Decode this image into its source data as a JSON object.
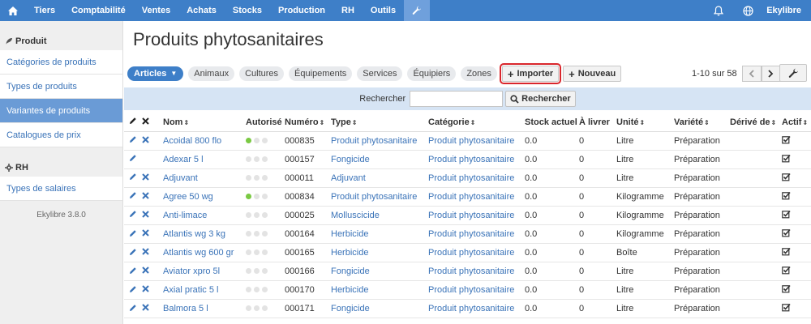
{
  "nav": {
    "items": [
      "Tiers",
      "Comptabilité",
      "Ventes",
      "Achats",
      "Stocks",
      "Production",
      "RH",
      "Outils"
    ],
    "user": "Ekylibre"
  },
  "sidebar": {
    "section1": "Produit",
    "items1": [
      "Catégories de produits",
      "Types de produits",
      "Variantes de produits",
      "Catalogues de prix"
    ],
    "section2": "RH",
    "items2": [
      "Types de salaires"
    ],
    "version": "Ekylibre 3.8.0"
  },
  "page": {
    "title": "Produits phytosanitaires"
  },
  "toolbar": {
    "active_tab": "Articles",
    "tabs": [
      "Animaux",
      "Cultures",
      "Équipements",
      "Services",
      "Équipiers",
      "Zones"
    ],
    "import_label": "Importer",
    "new_label": "Nouveau",
    "pager_text": "1-10 sur 58"
  },
  "search": {
    "label": "Rechercher",
    "button": "Rechercher",
    "value": ""
  },
  "table": {
    "headers": [
      "Nom",
      "Autorisé",
      "Numéro",
      "Type",
      "Catégorie",
      "Stock actuel",
      "À livrer",
      "Unité",
      "Variété",
      "Dérivé de",
      "Actif"
    ],
    "rows": [
      {
        "name": "Acoidal 800 flo",
        "authorized": 1,
        "number": "000835",
        "type": "Produit phytosanitaire",
        "category": "Produit phytosanitaire",
        "stock": "0.0",
        "to_deliver": "0",
        "unit": "Litre",
        "variety": "Préparation",
        "derived": "",
        "deletable": true
      },
      {
        "name": "Adexar 5 l",
        "authorized": 0,
        "number": "000157",
        "type": "Fongicide",
        "category": "Produit phytosanitaire",
        "stock": "0.0",
        "to_deliver": "0",
        "unit": "Litre",
        "variety": "Préparation",
        "derived": "",
        "deletable": false
      },
      {
        "name": "Adjuvant",
        "authorized": 0,
        "number": "000011",
        "type": "Adjuvant",
        "category": "Produit phytosanitaire",
        "stock": "0.0",
        "to_deliver": "0",
        "unit": "Litre",
        "variety": "Préparation",
        "derived": "",
        "deletable": true
      },
      {
        "name": "Agree 50 wg",
        "authorized": 1,
        "number": "000834",
        "type": "Produit phytosanitaire",
        "category": "Produit phytosanitaire",
        "stock": "0.0",
        "to_deliver": "0",
        "unit": "Kilogramme",
        "variety": "Préparation",
        "derived": "",
        "deletable": true
      },
      {
        "name": "Anti-limace",
        "authorized": 0,
        "number": "000025",
        "type": "Molluscicide",
        "category": "Produit phytosanitaire",
        "stock": "0.0",
        "to_deliver": "0",
        "unit": "Kilogramme",
        "variety": "Préparation",
        "derived": "",
        "deletable": true
      },
      {
        "name": "Atlantis wg 3 kg",
        "authorized": 0,
        "number": "000164",
        "type": "Herbicide",
        "category": "Produit phytosanitaire",
        "stock": "0.0",
        "to_deliver": "0",
        "unit": "Kilogramme",
        "variety": "Préparation",
        "derived": "",
        "deletable": true
      },
      {
        "name": "Atlantis wg 600 gr",
        "authorized": 0,
        "number": "000165",
        "type": "Herbicide",
        "category": "Produit phytosanitaire",
        "stock": "0.0",
        "to_deliver": "0",
        "unit": "Boîte",
        "variety": "Préparation",
        "derived": "",
        "deletable": true
      },
      {
        "name": "Aviator xpro 5l",
        "authorized": 0,
        "number": "000166",
        "type": "Fongicide",
        "category": "Produit phytosanitaire",
        "stock": "0.0",
        "to_deliver": "0",
        "unit": "Litre",
        "variety": "Préparation",
        "derived": "",
        "deletable": true
      },
      {
        "name": "Axial pratic 5 l",
        "authorized": 0,
        "number": "000170",
        "type": "Herbicide",
        "category": "Produit phytosanitaire",
        "stock": "0.0",
        "to_deliver": "0",
        "unit": "Litre",
        "variety": "Préparation",
        "derived": "",
        "deletable": true
      },
      {
        "name": "Balmora 5 l",
        "authorized": 0,
        "number": "000171",
        "type": "Fongicide",
        "category": "Produit phytosanitaire",
        "stock": "0.0",
        "to_deliver": "0",
        "unit": "Litre",
        "variety": "Préparation",
        "derived": "",
        "deletable": true
      }
    ]
  }
}
